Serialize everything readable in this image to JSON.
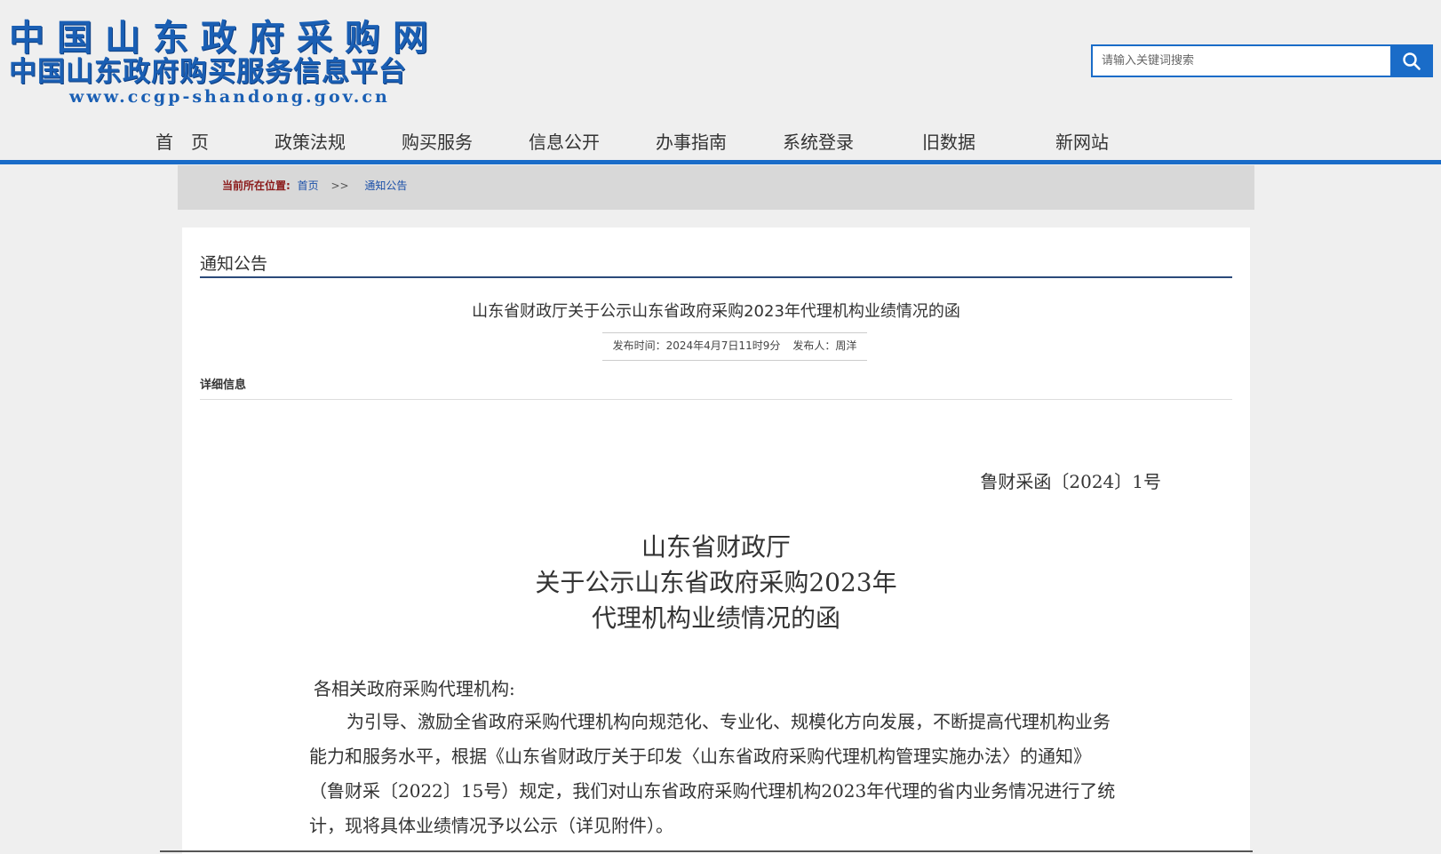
{
  "logo": {
    "line1": "中国山东政府采购网",
    "line2": "中国山东政府购买服务信息平台",
    "url": "www.ccgp-shandong.gov.cn"
  },
  "search": {
    "placeholder": "请输入关键词搜索",
    "button_icon": "search-icon"
  },
  "nav": {
    "items": [
      {
        "label": "首　页"
      },
      {
        "label": "政策法规"
      },
      {
        "label": "购买服务"
      },
      {
        "label": "信息公开"
      },
      {
        "label": "办事指南"
      },
      {
        "label": "系统登录"
      },
      {
        "label": "旧数据"
      },
      {
        "label": "新网站"
      }
    ]
  },
  "breadcrumb": {
    "label": "当前所在位置:",
    "home": "首页",
    "separator": ">>",
    "current": "通知公告"
  },
  "section": {
    "title": "通知公告"
  },
  "article": {
    "title": "山东省财政厅关于公示山东省政府采购2023年代理机构业绩情况的函",
    "publish_time": "发布时间：2024年4月7日11时9分",
    "publisher": "发布人：周洋",
    "detail_label": "详细信息",
    "doc_number": "鲁财采函〔2024〕1号",
    "heading": [
      "山东省财政厅",
      "关于公示山东省政府采购2023年",
      "代理机构业绩情况的函"
    ],
    "salutation": "各相关政府采购代理机构:",
    "body_lines": [
      "为引导、激励全省政府采购代理机构向规范化、专业化、规模化方向发展，不断提高代理机构业务",
      "能力和服务水平，根据《山东省财政厅关于印发〈山东省政府采购代理机构管理实施办法〉的通知》",
      "（鲁财采〔2022〕15号）规定，我们对山东省政府采购代理机构2023年代理的省内业务情况进行了统",
      "计，现将具体业绩情况予以公示（详见附件）。"
    ]
  },
  "colors": {
    "brand_blue": "#1a6cc8",
    "logo_blue": "#1a5fb4",
    "breadcrumb_label": "#8b1a1a"
  }
}
